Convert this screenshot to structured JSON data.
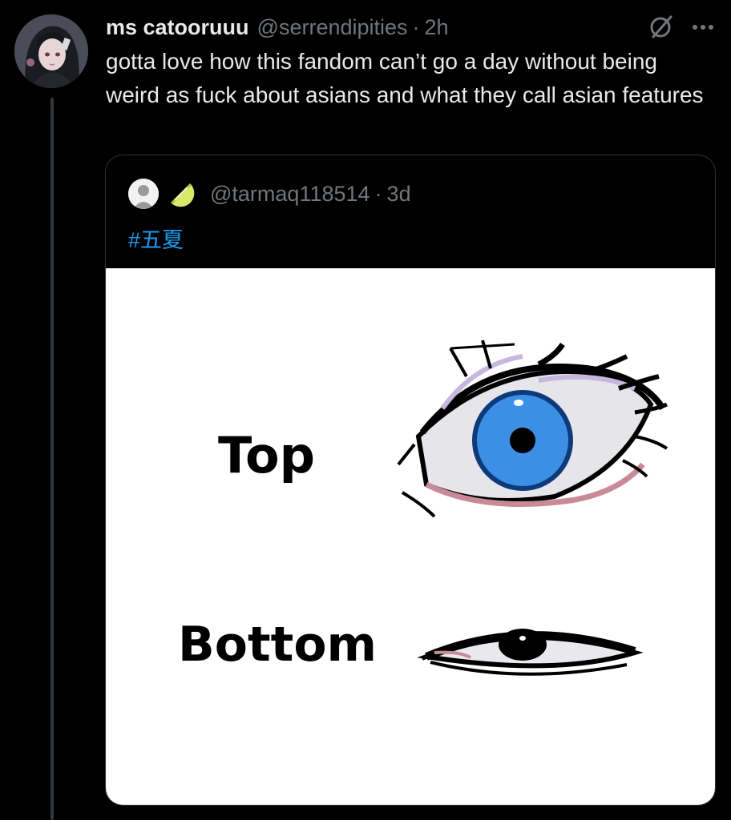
{
  "tweet": {
    "author": {
      "display_name": "ms catooruuu",
      "handle": "@serrendipities",
      "separator": "·",
      "time": "2h"
    },
    "icons": {
      "muted": "slashed-circle-icon",
      "more": "more-options-icon"
    },
    "text": "gotta love how this fandom can’t go a day without being weird as fuck about asians and what they call asian features"
  },
  "quote": {
    "handle": "@tarmaq118514",
    "separator": "·",
    "time": "3d",
    "emoji": "lime-icon",
    "hashtag": "#五夏",
    "media": {
      "top_label": "Top",
      "bottom_label": "Bottom",
      "top_eye_icon": "large-blue-eye-drawing",
      "bottom_eye_icon": "narrow-eye-drawing",
      "iris_color": "#3d8fe6"
    }
  },
  "colors": {
    "background": "#000000",
    "text": "#e7e9ea",
    "muted": "#71767b",
    "link": "#1d9bf0"
  }
}
